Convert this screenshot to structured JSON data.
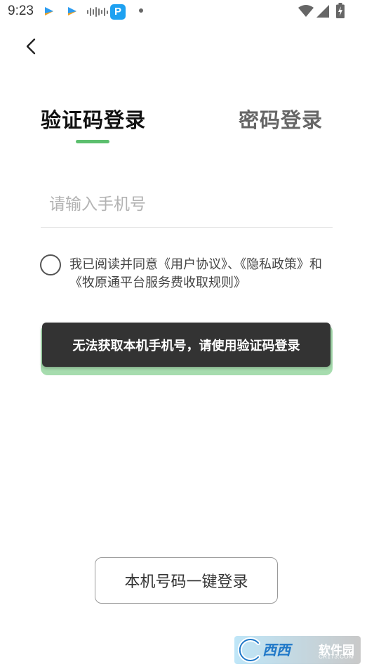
{
  "status_bar": {
    "time": "9:23",
    "icons": [
      "app-arrow-icon",
      "app-arrow-icon",
      "sound-wave-icon",
      "p-app-icon",
      "dot-icon",
      "wifi-icon",
      "signal-icon",
      "battery-icon"
    ],
    "p_app_letter": "P"
  },
  "nav": {
    "back_icon": "chevron-left-icon"
  },
  "tabs": [
    {
      "label": "验证码登录",
      "active": true
    },
    {
      "label": "密码登录",
      "active": false
    }
  ],
  "phone_input": {
    "placeholder": "请输入手机号",
    "value": ""
  },
  "agreement": {
    "checked": false,
    "text": "我已阅读并同意《用户协议》、《隐私政策》和《牧原通平台服务费收取规则》"
  },
  "toast": {
    "message": "无法获取本机手机号，请使用验证码登录"
  },
  "one_tap_login": {
    "label": "本机号码一键登录"
  },
  "watermark": {
    "brand": "西西",
    "subtitle": "软件园",
    "url": "CR173.COM"
  },
  "colors": {
    "accent_green": "#5cbf6e",
    "disabled_button_green": "#a6dcae",
    "toast_bg": "#333333"
  }
}
